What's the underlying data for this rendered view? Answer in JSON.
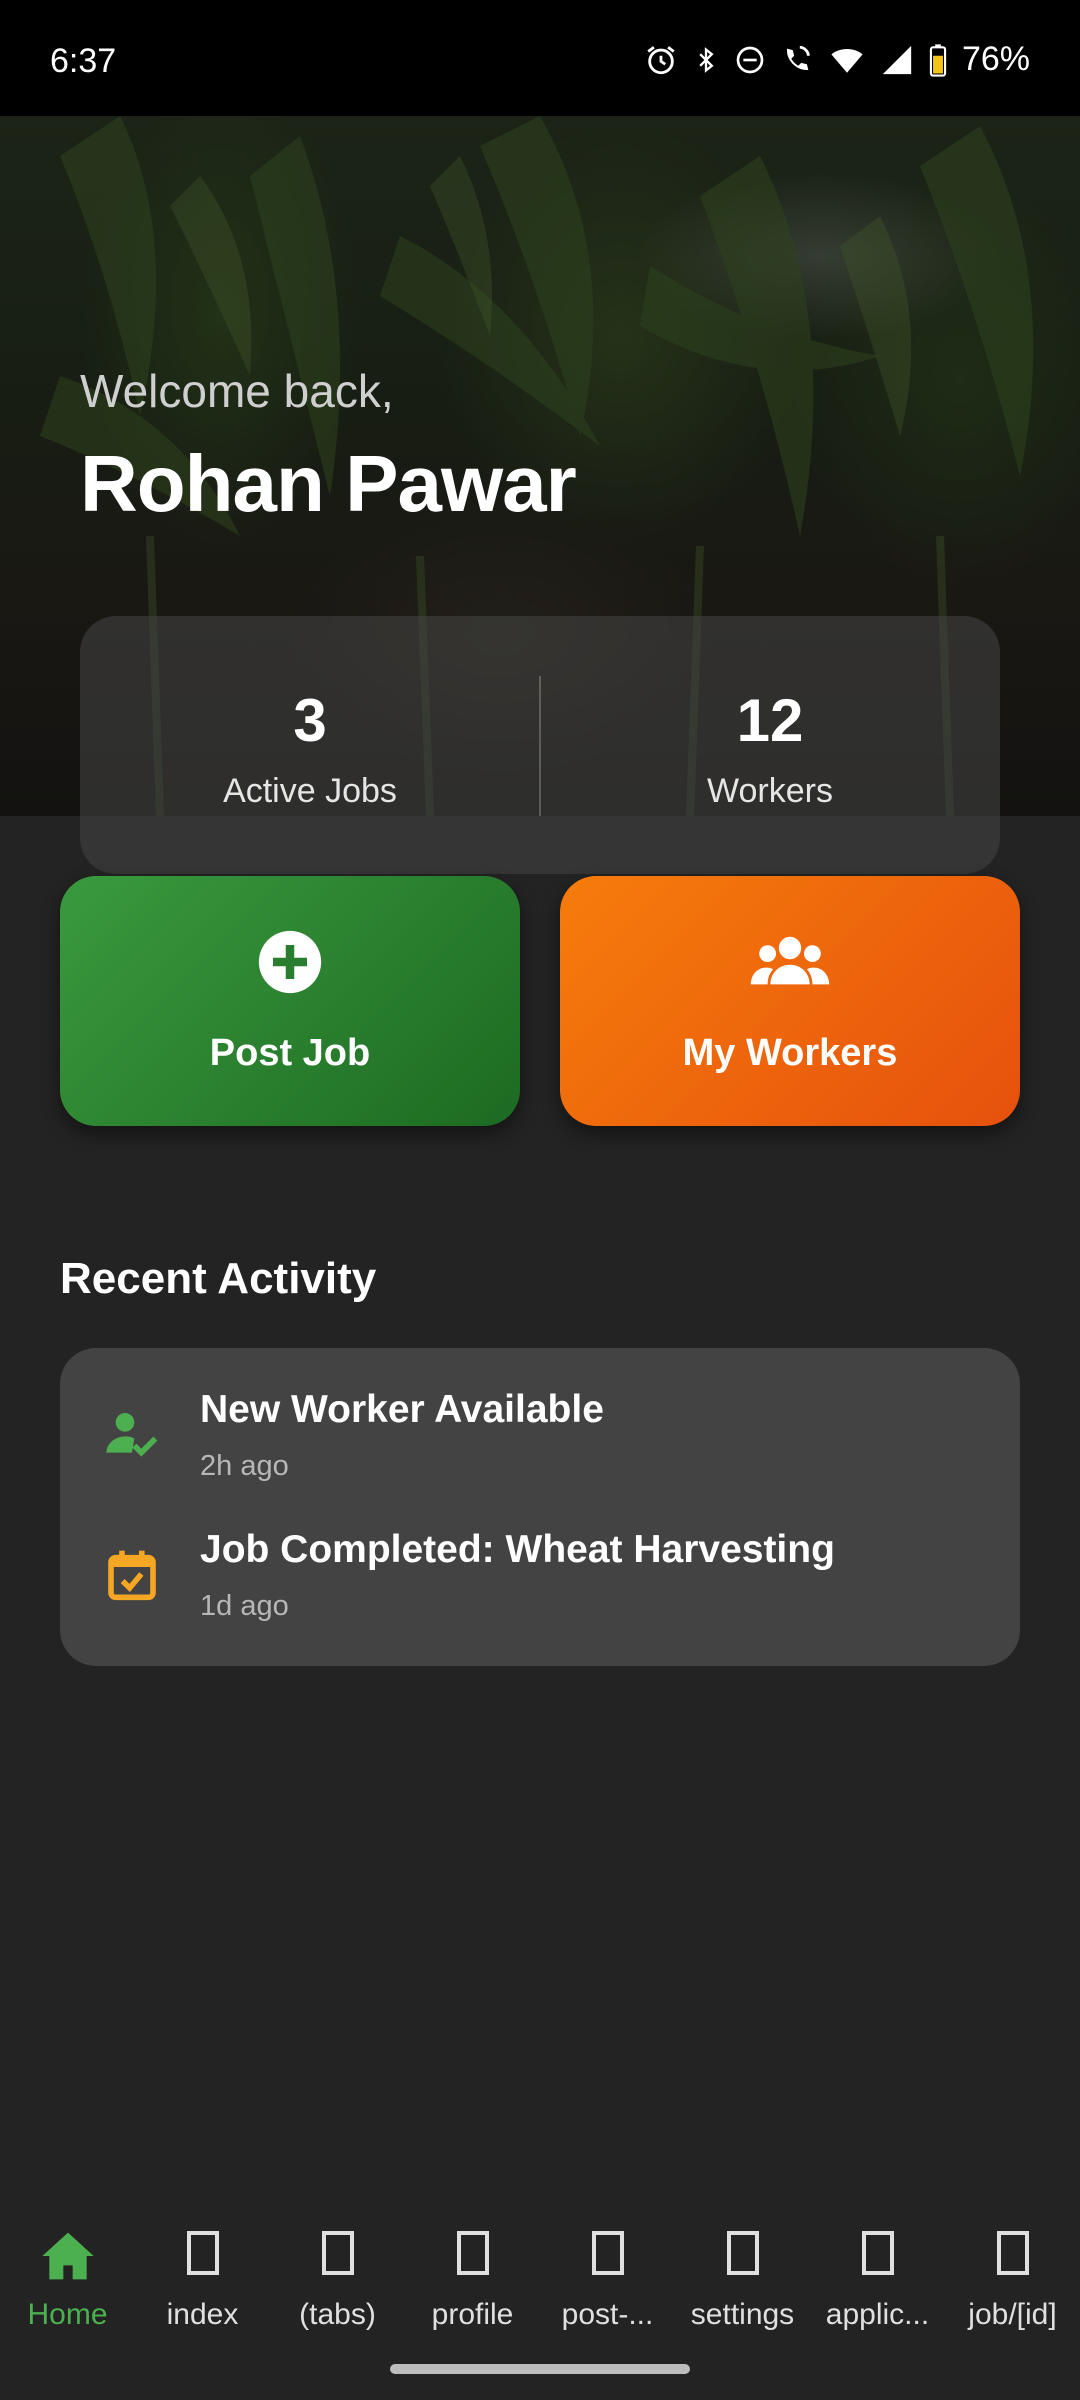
{
  "status_bar": {
    "time": "6:37",
    "battery": "76%",
    "icons": [
      "alarm-icon",
      "bluetooth-icon",
      "do-not-disturb-icon",
      "wifi-calling-icon",
      "wifi-icon",
      "cellular-signal-icon",
      "battery-icon"
    ]
  },
  "hero": {
    "welcome": "Welcome back,",
    "user_name": "Rohan Pawar"
  },
  "stats": {
    "active_jobs_value": "3",
    "active_jobs_label": "Active Jobs",
    "workers_value": "12",
    "workers_label": "Workers"
  },
  "actions": {
    "post_job_label": "Post Job",
    "post_job_icon": "plus-circle-icon",
    "my_workers_label": "My Workers",
    "my_workers_icon": "group-icon"
  },
  "recent_activity": {
    "title": "Recent Activity",
    "items": [
      {
        "title": "New Worker Available",
        "time": "2h ago",
        "icon": "person-check-icon",
        "color": "#4caf50"
      },
      {
        "title": "Job Completed: Wheat Harvesting",
        "time": "1d ago",
        "icon": "calendar-check-icon",
        "color": "#f5a623"
      }
    ]
  },
  "bottom_nav": {
    "items": [
      {
        "label": "Home",
        "icon": "home-icon",
        "active": true
      },
      {
        "label": "index",
        "icon": "placeholder-icon"
      },
      {
        "label": "(tabs)",
        "icon": "placeholder-icon"
      },
      {
        "label": "profile",
        "icon": "placeholder-icon"
      },
      {
        "label": "post-...",
        "icon": "placeholder-icon"
      },
      {
        "label": "settings",
        "icon": "placeholder-icon"
      },
      {
        "label": "applic...",
        "icon": "placeholder-icon"
      },
      {
        "label": "job/[id]",
        "icon": "placeholder-icon"
      }
    ]
  },
  "colors": {
    "accent_green": "#4caf50",
    "post_job_green": "#2e7d32",
    "workers_orange": "#ef6c00",
    "background": "#232323",
    "card": "#434343"
  }
}
